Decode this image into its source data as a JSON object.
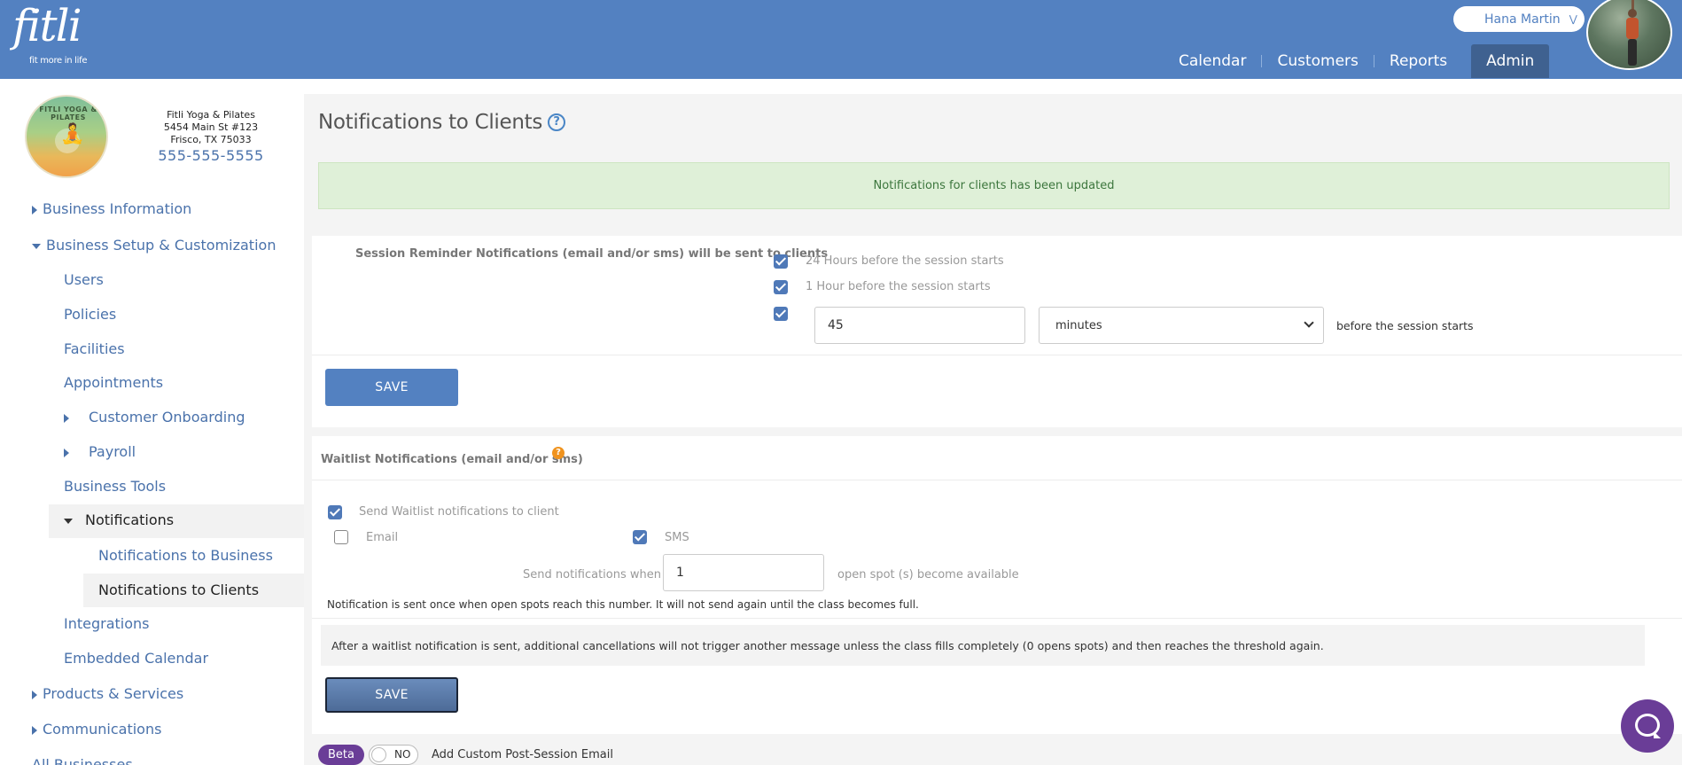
{
  "header": {
    "logo_word": "fitli",
    "logo_tagline": "fit more in life",
    "user_name": "Hana Martin",
    "nav": [
      {
        "label": "Calendar"
      },
      {
        "label": "Customers"
      },
      {
        "label": "Reports"
      },
      {
        "label": "Admin"
      }
    ],
    "active_nav": "Admin"
  },
  "business": {
    "logo_ring_text": "FITLI YOGA & PILATES",
    "name": "Fitli Yoga & Pilates",
    "address_line1": "5454 Main St #123",
    "address_line2": "Frisco, TX 75033",
    "phone": "555-555-5555"
  },
  "sidebar": {
    "business_information": "Business Information",
    "business_setup": "Business Setup & Customization",
    "users": "Users",
    "policies": "Policies",
    "facilities": "Facilities",
    "appointments": "Appointments",
    "customer_onboarding": "Customer Onboarding",
    "payroll": "Payroll",
    "business_tools": "Business Tools",
    "notifications": "Notifications",
    "notifications_business": "Notifications to Business",
    "notifications_clients": "Notifications to Clients",
    "integrations": "Integrations",
    "embedded_calendar": "Embedded Calendar",
    "products_services": "Products & Services",
    "communications": "Communications",
    "all_businesses": "All Businesses"
  },
  "page": {
    "title": "Notifications to Clients",
    "success_message": "Notifications for clients has been updated"
  },
  "session_reminders": {
    "label": "Session Reminder Notifications (email and/or sms) will be sent to clients",
    "option_24h": "24 Hours before the session starts",
    "option_1h": "1 Hour before the session starts",
    "custom_value": "45",
    "custom_unit": "minutes",
    "custom_suffix": "before the session starts",
    "checked_24h": true,
    "checked_1h": true,
    "checked_custom": true,
    "save_label": "SAVE"
  },
  "waitlist": {
    "title": "Waitlist Notifications (email and/or sms)",
    "send_label": "Send Waitlist notifications to client",
    "email_label": "Email",
    "sms_label": "SMS",
    "send_checked": true,
    "email_checked": false,
    "sms_checked": true,
    "send_when_label": "Send notifications when",
    "spots_value": "1",
    "spots_suffix": "open spot (s) become available",
    "note": "Notification is sent once when open spots reach this number. It will not send again until the class becomes full.",
    "info": "After a waitlist notification is sent, additional cancellations will not trigger another message unless the class fills completely (0 opens spots) and then reaches the threshold again.",
    "save_label": "SAVE"
  },
  "footer": {
    "beta_label": "Beta",
    "toggle_label": "NO",
    "custom_email_label": "Add Custom Post-Session Email"
  }
}
